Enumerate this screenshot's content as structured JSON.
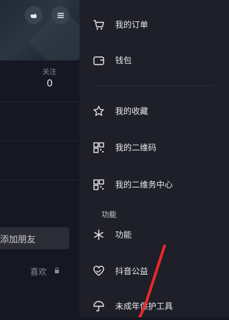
{
  "left": {
    "follow_label": "关注",
    "follow_count": "0",
    "add_friend_label": "添加朋友",
    "likes_label": "喜欢"
  },
  "menu": {
    "items": [
      {
        "label": "我的订单",
        "icon": "cart-icon"
      },
      {
        "label": "钱包",
        "icon": "wallet-icon"
      },
      {
        "label": "我的收藏",
        "icon": "star-icon"
      },
      {
        "label": "我的二维码",
        "icon": "qr-code-icon"
      },
      {
        "label": "我的二维务中心",
        "icon": "qr-code-icon"
      },
      {
        "label": "功能",
        "icon": "sparkle-icon"
      },
      {
        "label": "抖音公益",
        "icon": "heart-hands-icon"
      },
      {
        "label": "未成年保护工具",
        "icon": "umbrella-icon"
      }
    ],
    "section_label": "功能"
  },
  "colors": {
    "drawer_bg": "#1e1f29",
    "page_bg": "#161722",
    "annotation_stroke": "#e62a2a"
  }
}
